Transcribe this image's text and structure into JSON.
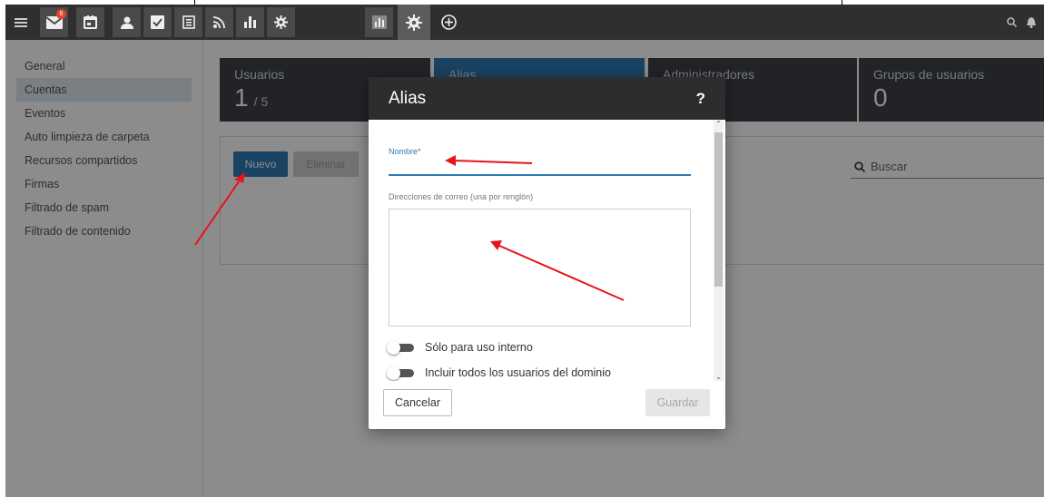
{
  "toolbar": {
    "mail_badge": "6",
    "apps": [
      {
        "icon": "menu-icon"
      },
      {
        "icon": "mail-icon"
      },
      {
        "icon": "calendar-icon"
      },
      {
        "icon": "contacts-icon"
      },
      {
        "icon": "tasks-icon"
      },
      {
        "icon": "notes-icon"
      },
      {
        "icon": "rss-icon"
      },
      {
        "icon": "reports-icon"
      },
      {
        "icon": "settings-icon"
      },
      {
        "icon": "domain-stats-icon"
      },
      {
        "icon": "domain-settings-icon"
      },
      {
        "icon": "add-icon"
      }
    ],
    "right_icons": [
      "search-icon",
      "bell-icon"
    ]
  },
  "sidebar": {
    "items": [
      {
        "label": "General"
      },
      {
        "label": "Cuentas",
        "selected": true
      },
      {
        "label": "Eventos"
      },
      {
        "label": "Auto limpieza de carpeta"
      },
      {
        "label": "Recursos compartidos"
      },
      {
        "label": "Firmas"
      },
      {
        "label": "Filtrado de spam"
      },
      {
        "label": "Filtrado de contenido"
      }
    ]
  },
  "stats": [
    {
      "label": "Usuarios",
      "value": "1",
      "suffix": "/ 5"
    },
    {
      "label": "Alias",
      "value": ""
    },
    {
      "label": "Administradores",
      "value": ""
    },
    {
      "label": "Grupos de usuarios",
      "value": "0"
    }
  ],
  "card": {
    "new_label": "Nuevo",
    "delete_label": "Eliminar",
    "search_placeholder": "Buscar"
  },
  "modal": {
    "title": "Alias",
    "help": "?",
    "name_label": "Nombre",
    "required_mark": "*",
    "name_value": "",
    "addresses_label": "Direcciones de correo (una por renglón)",
    "addresses_value": "",
    "toggle_internal": "Sólo para uso interno",
    "toggle_all_users": "Incluir todos los usuarios del dominio",
    "cancel_label": "Cancelar",
    "save_label": "Guardar"
  },
  "colors": {
    "accent": "#2e79b5",
    "toolbar": "#2f2f2f",
    "annotation": "#e8141a"
  }
}
